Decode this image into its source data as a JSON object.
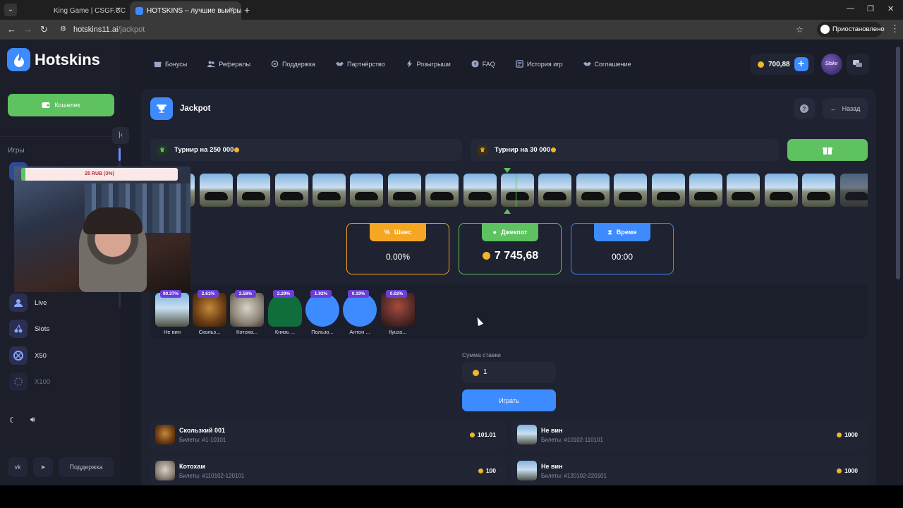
{
  "browser": {
    "tabs": [
      {
        "title": "King Game | CSGF.CC"
      },
      {
        "title": "HOTSKINS – лучшие выигрыш"
      }
    ],
    "url_domain": "hotskins11.ai",
    "url_path": "/jackpot",
    "profile_status": "Приостановлено"
  },
  "sidebar": {
    "logo": "Hotskins",
    "wallet_label": "Кошелек",
    "games_heading": "Игры",
    "games": [
      {
        "label": "Live",
        "icon": "live-user-icon"
      },
      {
        "label": "Slots",
        "icon": "slots-icon"
      },
      {
        "label": "X50",
        "icon": "x50-icon"
      },
      {
        "label": "X100",
        "icon": "x100-icon"
      }
    ],
    "support_label": "Поддержка"
  },
  "nav": {
    "items": [
      {
        "label": "Бонусы",
        "icon": "gift-icon"
      },
      {
        "label": "Рефералы",
        "icon": "users-icon"
      },
      {
        "label": "Поддержка",
        "icon": "headset-icon"
      },
      {
        "label": "Партнёрство",
        "icon": "handshake-icon"
      },
      {
        "label": "Розыгрыши",
        "icon": "bolt-icon"
      },
      {
        "label": "FAQ",
        "icon": "question-icon"
      },
      {
        "label": "История игр",
        "icon": "history-icon"
      },
      {
        "label": "Соглашение",
        "icon": "agreement-icon"
      }
    ],
    "balance": "700,88",
    "avatar_text": "Stake"
  },
  "jackpot": {
    "title": "Jackpot",
    "back_label": "Назад",
    "tournaments": [
      {
        "label": "Турнир на 250 000"
      },
      {
        "label": "Турнир на 30 000"
      }
    ],
    "stats": {
      "chance_label": "Шанс",
      "chance_value": "0.00%",
      "jackpot_label": "Джекпот",
      "jackpot_value": "7 745,68",
      "time_label": "Время",
      "time_value": "00:00"
    },
    "players": [
      {
        "percent": "90.37%",
        "name": "Не вин",
        "avatar": "car"
      },
      {
        "percent": "2.61%",
        "name": "Скольз...",
        "avatar": "lion"
      },
      {
        "percent": "2.58%",
        "name": "Котоха...",
        "avatar": "cat"
      },
      {
        "percent": "2.29%",
        "name": "Князь ...",
        "avatar": "emblem"
      },
      {
        "percent": "1.92%",
        "name": "Пользо...",
        "avatar": "flame"
      },
      {
        "percent": "0.19%",
        "name": "Антон ...",
        "avatar": "flame"
      },
      {
        "percent": "0.02%",
        "name": "Ilyuss...",
        "avatar": "lion2"
      }
    ],
    "bet_label": "Сумма ставки",
    "bet_value": "1",
    "play_label": "Играть",
    "bets": [
      {
        "name": "Скользкий 001",
        "tickets": "Билеты: #1-10101",
        "amount": "101.01",
        "avatar": "lion"
      },
      {
        "name": "Не вин",
        "tickets": "Билеты: #10102-110101",
        "amount": "1000",
        "avatar": "car"
      },
      {
        "name": "Котохам",
        "tickets": "Билеты: #110102-120101",
        "amount": "100",
        "avatar": "cat"
      },
      {
        "name": "Не вин",
        "tickets": "Билеты: #120102-220101",
        "amount": "1000",
        "avatar": "car"
      }
    ]
  },
  "overlay": {
    "donation": "25 RUB (3%)"
  },
  "colors": {
    "accent_blue": "#3d8bff",
    "green": "#5dc25f",
    "orange": "#f5a623",
    "purple_badge": "#6a3fd8",
    "background": "#1a1c27"
  }
}
